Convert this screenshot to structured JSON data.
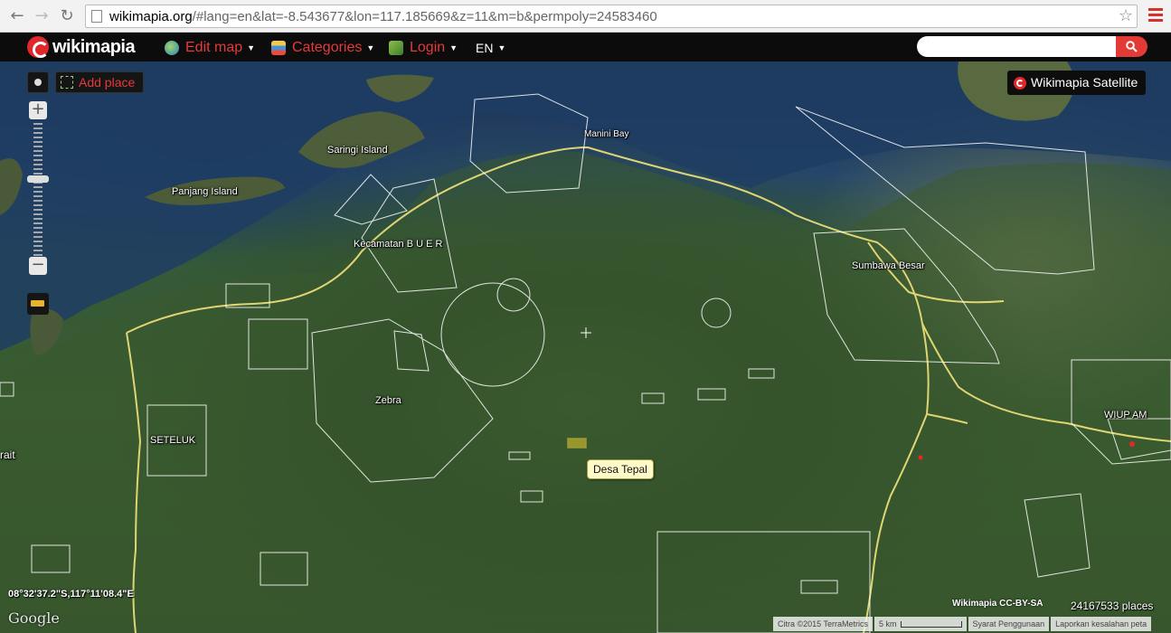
{
  "browser": {
    "url_host": "wikimapia.org",
    "url_rest": "/#lang=en&lat=-8.543677&lon=117.185669&z=11&m=b&permpoly=24583460",
    "icons": [
      "back-arrow-icon",
      "forward-arrow-icon",
      "reload-icon",
      "page-icon",
      "star-icon",
      "menu-icon"
    ]
  },
  "header": {
    "logo_text": "wikimapia",
    "edit_map_label": "Edit map",
    "categories_label": "Categories",
    "login_label": "Login",
    "language_label": "EN",
    "search_placeholder": "",
    "accent_color": "#e53a3a"
  },
  "controls": {
    "add_place_label": "Add place",
    "layer_label": "Wikimapia Satellite",
    "zoom_in": "+",
    "zoom_out": "−",
    "zoom_level": 11
  },
  "map": {
    "labels": {
      "saringi": "Saringi Island",
      "panjang": "Panjang Island",
      "manini": "Manini Bay",
      "buer": "Kecamatan B U E R",
      "sumbawa": "Sumbawa Besar",
      "zebra": "Zebra",
      "seteluk": "SETELUK",
      "wiup": "WIUP AM",
      "strait": "rait"
    },
    "tooltip": "Desa Tepal",
    "coordinates": "08°32'37.2\"S,117°11'08.4\"E",
    "google_logo": "Google",
    "license": "Wikimapia CC-BY-SA",
    "places_count": "24167533 places",
    "attribution": {
      "imagery": "Citra ©2015 TerraMetrics",
      "scale": "5 km",
      "terms": "Syarat Penggunaan",
      "report": "Laporkan kesalahan peta"
    }
  }
}
